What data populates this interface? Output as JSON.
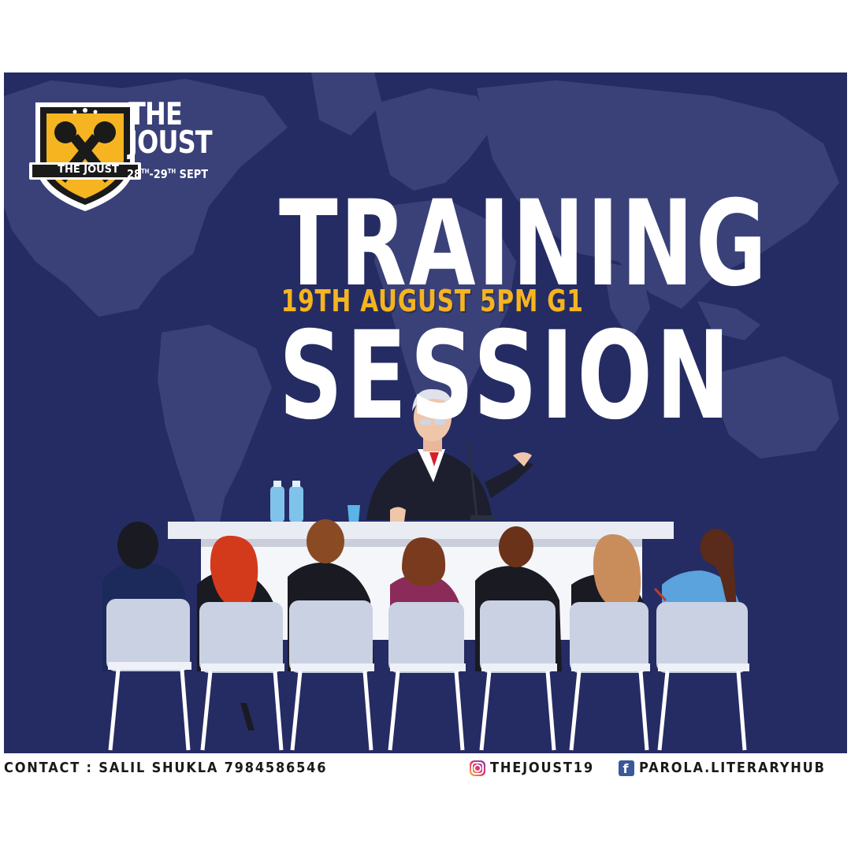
{
  "brand": {
    "badge_label": "THE JOUST",
    "title_line1": "THE",
    "title_line2": "JOUST",
    "dates": {
      "start_day": "28",
      "start_suffix": "TH",
      "end_day": "29",
      "end_suffix": "TH",
      "month": "SEPT"
    }
  },
  "headline": {
    "line1": "TRAINING",
    "details": "19TH AUGUST 5PM G1",
    "line2": "SESSION"
  },
  "footer": {
    "contact": "CONTACT : SALIL SHUKLA 7984586546",
    "instagram_handle": "THEJOUST19",
    "facebook_handle": "PAROLA.LITERARYHUB",
    "facebook_glyph": "f"
  },
  "colors": {
    "background": "#252c63",
    "map": "#3a4178",
    "accent": "#f5b420",
    "text": "#ffffff"
  },
  "icons": [
    "microphone-icon",
    "star-icon",
    "instagram-icon",
    "facebook-icon"
  ]
}
